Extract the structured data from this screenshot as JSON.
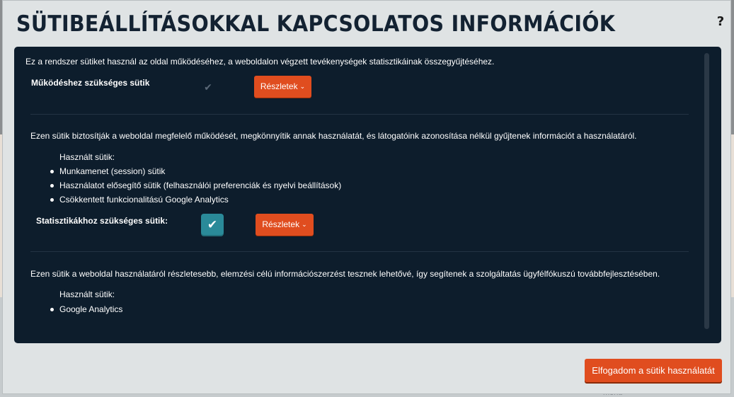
{
  "modal": {
    "title": "SÜTIBEÁLLÍTÁSOKKAL KAPCSOLATOS INFORMÁCIÓK",
    "help": "?",
    "intro": "Ez a rendszer sütiket használ az oldal működéséhez, a weboldalon végzett tevékenységek statisztikáinak összegyűjtéséhez.",
    "accept_label": "Elfogadom a sütik használatát"
  },
  "categories": [
    {
      "label": "Működéshez szükséges sütik",
      "checked": true,
      "check_glyph": "✔",
      "details_label": "Részletek",
      "description": "Ezen sütik biztosítják a weboldal megfelelő működését, megkönnyítik annak használatát, és látogatóink azonosítása nélkül gyűjtenek információt a használatáról.",
      "used_title": "Használt sütik:",
      "items": [
        "Munkamenet (session) sütik",
        "Használatot elősegítő sütik (felhasználói preferenciák és nyelvi beállítások)",
        "Csökkentett funkcionalitású Google Analytics"
      ]
    },
    {
      "label": "Statisztikákhoz szükséges sütik:",
      "checked": true,
      "check_glyph": "✔",
      "details_label": "Részletek",
      "description": "Ezen sütik a weboldal használatáról részletesebb, elemzési célú információszerzést tesznek lehetővé, így segítenek a szolgáltatás ügyfélfókuszú továbbfejlesztésében.",
      "used_title": "Használt sütik:",
      "items": [
        "Google Analytics"
      ]
    }
  ],
  "chevron_glyph": "⌄",
  "background": {
    "partial_text": "menü"
  },
  "colors": {
    "panel_bg": "#0d1d2c",
    "accent_orange": "#e04d1f",
    "toggle_teal": "#2a8a99",
    "title_navy": "#132232"
  }
}
